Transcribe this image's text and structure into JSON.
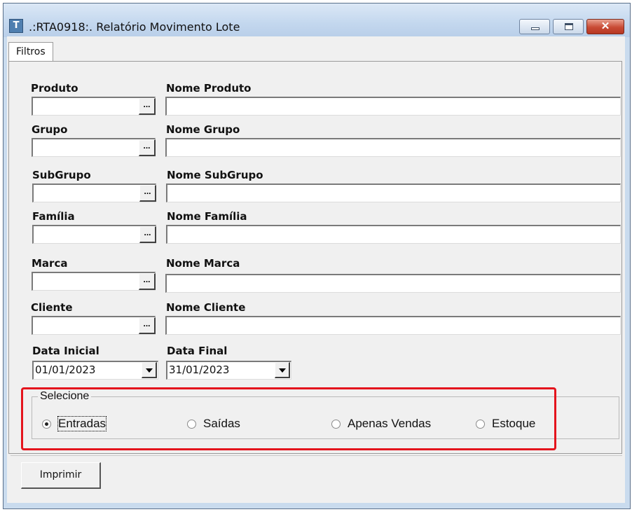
{
  "window": {
    "title": ".:RTA0918:. Relatório Movimento Lote",
    "app_icon": "T",
    "close_glyph": "✕"
  },
  "tabs": [
    {
      "label": "Filtros"
    }
  ],
  "fields": {
    "produto": {
      "code_label": "Produto",
      "name_label": "Nome Produto",
      "code_value": "",
      "name_value": ""
    },
    "grupo": {
      "code_label": "Grupo",
      "name_label": "Nome Grupo",
      "code_value": "",
      "name_value": ""
    },
    "subgrupo": {
      "code_label": "SubGrupo",
      "name_label": "Nome SubGrupo",
      "code_value": "",
      "name_value": ""
    },
    "familia": {
      "code_label": "Família",
      "name_label": "Nome Família",
      "code_value": "",
      "name_value": ""
    },
    "marca": {
      "code_label": "Marca",
      "name_label": "Nome Marca",
      "code_value": "",
      "name_value": ""
    },
    "cliente": {
      "code_label": "Cliente",
      "name_label": "Nome Cliente",
      "code_value": "",
      "name_value": ""
    }
  },
  "lookup_button_label": "...",
  "dates": {
    "inicial": {
      "label": "Data Inicial",
      "value": "01/01/2023"
    },
    "final": {
      "label": "Data Final",
      "value": "31/01/2023"
    }
  },
  "selecione": {
    "title": "Selecione",
    "options": [
      {
        "label": "Entradas",
        "selected": true
      },
      {
        "label": "Saídas",
        "selected": false
      },
      {
        "label": "Apenas Vendas",
        "selected": false
      },
      {
        "label": "Estoque",
        "selected": false
      }
    ]
  },
  "buttons": {
    "print_label": "Imprimir"
  },
  "colors": {
    "highlight": "#e4141d",
    "titlebar": "#c3d7ee",
    "close_button": "#c84b35"
  }
}
